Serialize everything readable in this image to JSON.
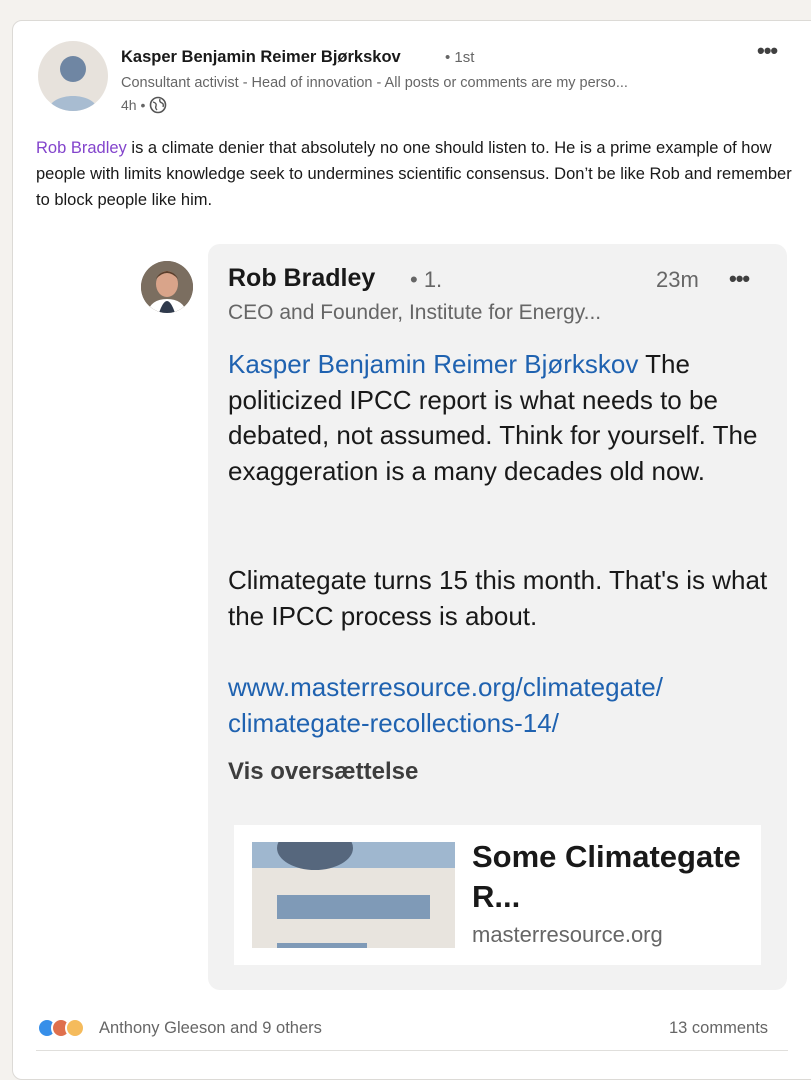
{
  "post": {
    "author_name": "Kasper Benjamin Reimer Bjørkskov",
    "degree": "• 1st",
    "headline": "Consultant activist - Head of innovation - All posts or comments are my perso...",
    "time": "4h •",
    "mention": "Rob Bradley",
    "text": " is a climate denier that absolutely no one should listen to. He is a prime example of how people with limits knowledge seek to undermines scientific consensus. Don’t be like Rob and remember to block people like him."
  },
  "comment": {
    "author_name": "Rob Bradley",
    "degree": "• 1.",
    "time": "23m",
    "headline": "CEO and Founder, Institute for Energy...",
    "mention": "Kasper Benjamin Reimer Bjørkskov",
    "text": " The politicized IPCC report is what needs to be debated, not assumed. Think for yourself. The exaggeration is a many decades old now.",
    "text2": "Climategate turns 15 this month. That's is what the IPCC process is about.",
    "link": "www.masterresource.org/climategate/climategate-recollections-14/",
    "translate_label": "Vis oversættelse",
    "preview": {
      "title": "Some Climategate R...",
      "domain": "masterresource.org"
    }
  },
  "footer": {
    "reaction_names": "Anthony Gleeson and 9 others",
    "comments_count": "13 comments"
  },
  "icons": {
    "menu": "more-horizontal-icon",
    "globe": "globe-icon",
    "reactions": [
      "like-icon",
      "love-icon",
      "insightful-icon"
    ]
  },
  "colors": {
    "mention_post": "#8344cc",
    "mention_comment": "#1f62b0",
    "link": "#1f62b0",
    "bubble": "#f2f2f2"
  }
}
